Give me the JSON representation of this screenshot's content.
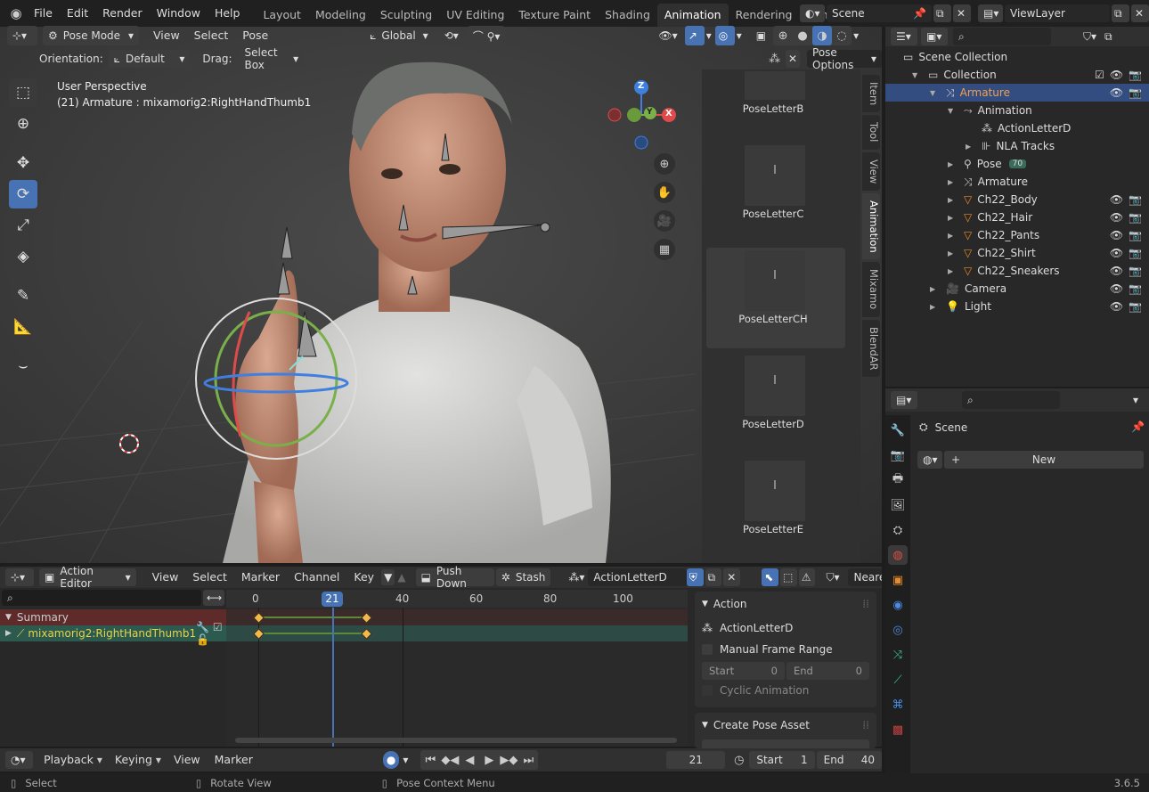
{
  "topbar": {
    "menus": [
      "File",
      "Edit",
      "Render",
      "Window",
      "Help"
    ],
    "workspaces": [
      "Layout",
      "Modeling",
      "Sculpting",
      "UV Editing",
      "Texture Paint",
      "Shading",
      "Animation",
      "Rendering",
      "Compositing"
    ],
    "active_workspace": "Animation",
    "scene": "Scene",
    "view_layer": "ViewLayer"
  },
  "viewport": {
    "mode": "Pose Mode",
    "menus": [
      "View",
      "Select",
      "Pose"
    ],
    "transform_orientation": "Global",
    "orientation_label": "Orientation:",
    "orientation_value": "Default",
    "drag_label": "Drag:",
    "drag_value": "Select Box",
    "pose_options": "Pose Options",
    "overlay_title": "User Perspective",
    "overlay_subtitle": "(21) Armature : mixamorig2:RightHandThumb1",
    "gizmo": {
      "z": "Z",
      "y": "Y",
      "x": "X"
    }
  },
  "side_tabs": [
    "Item",
    "Tool",
    "View",
    "Animation",
    "Mixamo",
    "BlendAR"
  ],
  "active_side_tab": "Animation",
  "pose_library": [
    "PoseLetterB",
    "PoseLetterC",
    "PoseLetterCH",
    "PoseLetterD",
    "PoseLetterE"
  ],
  "outliner": {
    "root": "Scene Collection",
    "rows": [
      {
        "label": "Collection",
        "indent": 1
      },
      {
        "label": "Armature",
        "indent": 2,
        "selected": true
      },
      {
        "label": "Animation",
        "indent": 3
      },
      {
        "label": "ActionLetterD",
        "indent": 4
      },
      {
        "label": "NLA Tracks",
        "indent": 4
      },
      {
        "label": "Pose",
        "indent": 3,
        "badge": "70"
      },
      {
        "label": "Armature",
        "indent": 3
      },
      {
        "label": "Ch22_Body",
        "indent": 3
      },
      {
        "label": "Ch22_Hair",
        "indent": 3
      },
      {
        "label": "Ch22_Pants",
        "indent": 3
      },
      {
        "label": "Ch22_Shirt",
        "indent": 3
      },
      {
        "label": "Ch22_Sneakers",
        "indent": 3
      },
      {
        "label": "Camera",
        "indent": 2
      },
      {
        "label": "Light",
        "indent": 2
      }
    ]
  },
  "properties": {
    "title": "Scene",
    "new_button": "New"
  },
  "action_editor": {
    "mode": "Action Editor",
    "menus": [
      "View",
      "Select",
      "Marker",
      "Channel",
      "Key"
    ],
    "push_down": "Push Down",
    "stash": "Stash",
    "action_name": "ActionLetterD",
    "snapping": "Neares",
    "ruler": [
      "0",
      "21",
      "40",
      "60",
      "80",
      "100"
    ],
    "current_frame_badge": "21",
    "channels": {
      "summary": "Summary",
      "bone": "mixamorig2:RightHandThumb1"
    },
    "keyframes_frames": [
      1,
      30
    ],
    "panel": {
      "title": "Action",
      "action_name": "ActionLetterD",
      "manual_frame_range": "Manual Frame Range",
      "start_label": "Start",
      "start_value": "0",
      "end_label": "End",
      "end_value": "0",
      "cyclic": "Cyclic Animation",
      "pose_asset": "Create Pose Asset"
    }
  },
  "timeline": {
    "menus": [
      "Playback",
      "Keying",
      "View",
      "Marker"
    ],
    "current_frame": "21",
    "start_label": "Start",
    "start_value": "1",
    "end_label": "End",
    "end_value": "40"
  },
  "statusbar": {
    "select": "Select",
    "rotate": "Rotate View",
    "context": "Pose Context Menu",
    "version": "3.6.5"
  },
  "colors": {
    "accent": "#4772b3",
    "selected_row": "#334d80",
    "keyframe": "#f2b94a",
    "summary_bg": "#5e2a2a",
    "channel_bg": "#2c5a4e"
  }
}
